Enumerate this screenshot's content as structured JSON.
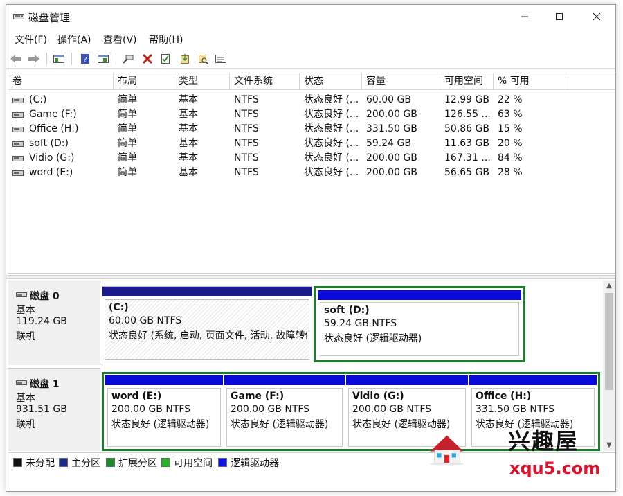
{
  "window": {
    "title": "磁盘管理",
    "min": "—",
    "max": "☐",
    "close": "✕"
  },
  "menu": [
    "文件(F)",
    "操作(A)",
    "查看(V)",
    "帮助(H)"
  ],
  "toolbar": {
    "icons": [
      "back-icon",
      "forward-icon",
      "console-tree-icon",
      "help-icon",
      "properties-icon",
      "connect-icon",
      "delete-icon",
      "check-icon",
      "export-icon",
      "search-icon",
      "list-icon"
    ]
  },
  "volumes": {
    "headers": [
      "卷",
      "布局",
      "类型",
      "文件系统",
      "状态",
      "容量",
      "可用空间",
      "% 可用"
    ],
    "rows": [
      [
        "(C:)",
        "简单",
        "基本",
        "NTFS",
        "状态良好 (...",
        "60.00 GB",
        "12.99 GB",
        "22 %"
      ],
      [
        "Game (F:)",
        "简单",
        "基本",
        "NTFS",
        "状态良好 (...",
        "200.00 GB",
        "126.55 ...",
        "63 %"
      ],
      [
        "Office (H:)",
        "简单",
        "基本",
        "NTFS",
        "状态良好 (...",
        "331.50 GB",
        "50.86 GB",
        "15 %"
      ],
      [
        "soft (D:)",
        "简单",
        "基本",
        "NTFS",
        "状态良好 (...",
        "59.24 GB",
        "11.63 GB",
        "20 %"
      ],
      [
        "Vidio (G:)",
        "简单",
        "基本",
        "NTFS",
        "状态良好 (...",
        "200.00 GB",
        "167.31 ...",
        "84 %"
      ],
      [
        "word (E:)",
        "简单",
        "基本",
        "NTFS",
        "状态良好 (...",
        "200.00 GB",
        "56.65 GB",
        "28 %"
      ]
    ]
  },
  "disks": [
    {
      "name": "磁盘 0",
      "type": "基本",
      "size": "119.24 GB",
      "status": "联机",
      "partitions": [
        {
          "name": "(C:)",
          "size": "60.00 GB NTFS",
          "status": "状态良好 (系统, 启动, 页面文件, 活动, 故障转储"
        },
        {
          "name": "soft  (D:)",
          "size": "59.24 GB NTFS",
          "status": "状态良好 (逻辑驱动器)"
        }
      ]
    },
    {
      "name": "磁盘 1",
      "type": "基本",
      "size": "931.51 GB",
      "status": "联机",
      "partitions": [
        {
          "name": "word  (E:)",
          "size": "200.00 GB NTFS",
          "status": "状态良好 (逻辑驱动器)"
        },
        {
          "name": "Game  (F:)",
          "size": "200.00 GB NTFS",
          "status": "状态良好 (逻辑驱动器)"
        },
        {
          "name": "Vidio  (G:)",
          "size": "200.00 GB NTFS",
          "status": "状态良好 (逻辑驱动器)"
        },
        {
          "name": "Office  (H:)",
          "size": "331.50 GB NTFS",
          "status": "状态良好 (逻辑驱动器)"
        }
      ]
    }
  ],
  "legend": [
    {
      "label": "未分配",
      "color": "#111111"
    },
    {
      "label": "主分区",
      "color": "#1a2a8c"
    },
    {
      "label": "扩展分区",
      "color": "#1a8a2a"
    },
    {
      "label": "可用空间",
      "color": "#2ab02a"
    },
    {
      "label": "逻辑驱动器",
      "color": "#1010e0"
    }
  ],
  "colors": {
    "primary_bar": "#1a1a8a",
    "logical_bar": "#0a0ad8",
    "extended_border": "#1b7f2a"
  },
  "watermark": {
    "cn": "兴趣屋",
    "en": "xqu5.com"
  }
}
